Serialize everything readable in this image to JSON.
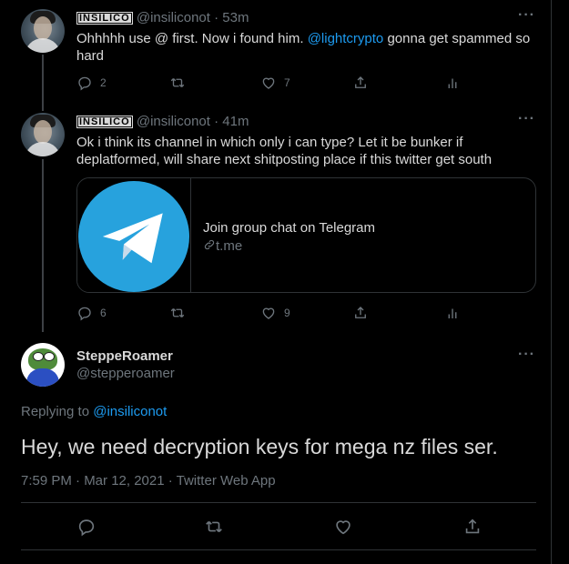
{
  "thread": [
    {
      "display_name": "INSILICO",
      "handle": "@insiliconot",
      "time": "· 53m",
      "more": "···",
      "text_prefix": "Ohhhhh use @ first. Now i found him. ",
      "text_mention": "@lightcrypto",
      "text_suffix": " gonna get spammed so hard",
      "replies": "2",
      "retweets": "",
      "likes": "7"
    },
    {
      "display_name": "INSILICO",
      "handle": "@insiliconot",
      "time": "· 41m",
      "more": "···",
      "text": "Ok i think its channel in which only i can type? Let it be bunker if deplatformed, will share next shitposting place if this twitter get south",
      "card": {
        "title": "Join group chat on Telegram",
        "domain": "t.me"
      },
      "replies": "6",
      "retweets": "",
      "likes": "9"
    }
  ],
  "main_tweet": {
    "display_name": "SteppeRoamer",
    "handle": "@stepperoamer",
    "more": "···",
    "replying_prefix": "Replying to ",
    "replying_to": "@insiliconot",
    "text": "Hey, we need decryption keys for mega nz files ser.",
    "meta": "7:59 PM · Mar 12, 2021 · Twitter Web App"
  },
  "icons": {
    "reply": "reply-icon",
    "retweet": "retweet-icon",
    "like": "heart-icon",
    "share": "share-icon",
    "analytics": "analytics-icon",
    "link": "link-icon",
    "telegram": "telegram-logo"
  },
  "colors": {
    "background": "#000000",
    "text": "#d9d9d9",
    "secondary": "#6e767d",
    "link": "#1d9bf0",
    "telegram": "#27a2dd"
  }
}
